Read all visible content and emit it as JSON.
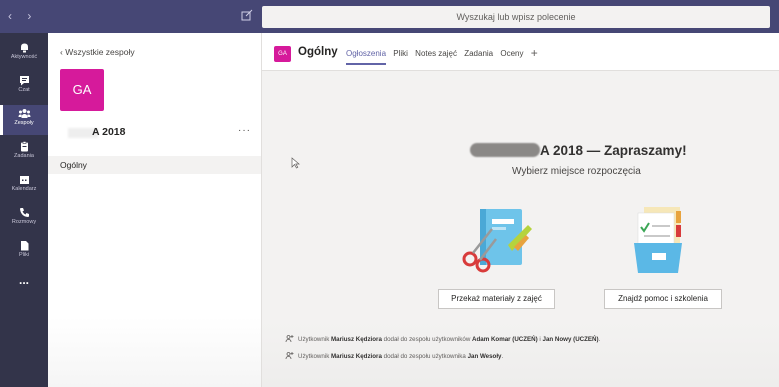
{
  "topbar": {
    "nav_arrows": "‹ ›",
    "search_placeholder": "Wyszukaj lub wpisz polecenie",
    "compose_icon": "compose-icon"
  },
  "rail": [
    {
      "label": "Aktywność",
      "icon": "bell-icon",
      "active": false
    },
    {
      "label": "Czat",
      "icon": "chat-icon",
      "active": false
    },
    {
      "label": "Zespoły",
      "icon": "teams-icon",
      "active": true
    },
    {
      "label": "Zadania",
      "icon": "assignments-icon",
      "active": false
    },
    {
      "label": "Kalendarz",
      "icon": "calendar-icon",
      "active": false
    },
    {
      "label": "Rozmowy",
      "icon": "phone-icon",
      "active": false
    },
    {
      "label": "Pliki",
      "icon": "files-icon",
      "active": false
    },
    {
      "label": "...",
      "icon": "more-icon",
      "active": false
    }
  ],
  "panel": {
    "back_label": "‹  Wszystkie zespoły",
    "team_initials": "GA",
    "team_name": "A 2018",
    "more": "···",
    "channel": "Ogólny"
  },
  "header": {
    "initials": "GA",
    "title": "Ogólny",
    "tabs": [
      "Ogłoszenia",
      "Pliki",
      "Notes zajęć",
      "Zadania",
      "Oceny"
    ],
    "active_tab": "Ogłoszenia",
    "add_tab": "+"
  },
  "welcome": {
    "title": "A 2018 — Zapraszamy!",
    "subtitle": "Wybierz miejsce rozpoczęcia",
    "buttons": [
      "Przekaż materiały z zajęć",
      "Znajdź pomoc i szkolenia"
    ]
  },
  "activity": [
    {
      "prefix": "Użytkownik ",
      "actor": "Mariusz Kędziora",
      "middle": " dodał do zespołu użytkowników ",
      "target": "Adam Komar (UCZEŃ)",
      "joiner": " i ",
      "target2": "Jan Nowy (UCZEŃ)",
      "suffix": "."
    },
    {
      "prefix": "Użytkownik ",
      "actor": "Mariusz Kędziora",
      "middle": " dodał do zespołu użytkownika ",
      "target": "Jan Wesoły",
      "joiner": "",
      "target2": "",
      "suffix": "."
    }
  ],
  "colors": {
    "topbar": "#464775",
    "rail": "#33344a",
    "accent": "#6264a7",
    "team_tile": "#d61a9b"
  }
}
